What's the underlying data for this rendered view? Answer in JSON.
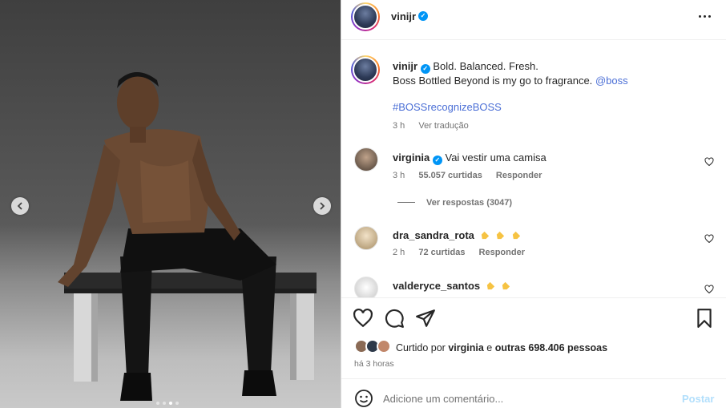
{
  "post": {
    "username": "vinijr",
    "caption_line1": "Bold. Balanced. Fresh.",
    "caption_line2_text": "Boss Bottled Beyond is my go to fragrance.",
    "caption_mention": "@boss",
    "caption_hashtag": "#BOSSrecognizeBOSS",
    "caption_time": "3 h",
    "caption_translate": "Ver tradução"
  },
  "comments": [
    {
      "username": "virginia",
      "text": "Vai vestir uma camisa",
      "time": "3 h",
      "likes": "55.057 curtidas",
      "reply": "Responder",
      "view_replies": "Ver respostas (3047)"
    },
    {
      "username": "dra_sandra_rota",
      "time": "2 h",
      "likes": "72 curtidas",
      "reply": "Responder",
      "emoji": "clapping-hands x3"
    },
    {
      "username": "valderyce_santos",
      "emoji": "clapping-hands x2"
    }
  ],
  "liked": {
    "prefix": "Curtido por",
    "user": "virginia",
    "middle": "e",
    "others": "outras 698.406 pessoas"
  },
  "time_ago": "há 3 horas",
  "comment_box": {
    "placeholder": "Adicione um comentário...",
    "post_label": "Postar"
  },
  "carousel": {
    "slides": 4,
    "active_index": 2
  },
  "colors": {
    "verified": "#0095f6",
    "hashtag": "#4b6fd6",
    "post_button_disabled": "#b2dffc",
    "secondary_text": "#737373"
  }
}
